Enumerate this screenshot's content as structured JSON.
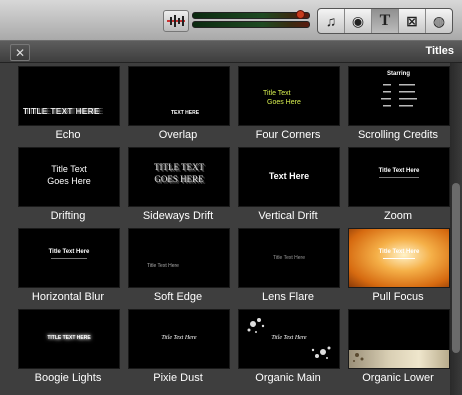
{
  "panel": {
    "title": "Titles",
    "close_glyph": "✕"
  },
  "toolbar": {
    "audio_button": "audio-waveform-icon",
    "buttons": [
      {
        "name": "music-icon",
        "glyph": "♫"
      },
      {
        "name": "camera-icon",
        "glyph": "◉"
      },
      {
        "name": "titles-icon",
        "glyph": "T"
      },
      {
        "name": "transitions-icon",
        "glyph": "⊠"
      },
      {
        "name": "globe-icon",
        "glyph": "◍"
      }
    ]
  },
  "tiles": [
    {
      "label": "Echo",
      "preview": [
        "TITLE TEXT HERE"
      ]
    },
    {
      "label": "Overlap",
      "preview": [
        "TEXT HERE"
      ]
    },
    {
      "label": "Four Corners",
      "preview": [
        "Title Text",
        "Goes Here"
      ]
    },
    {
      "label": "Scrolling Credits",
      "preview": [
        "Starring"
      ]
    },
    {
      "label": "Drifting",
      "preview": [
        "Title Text",
        "Goes Here"
      ]
    },
    {
      "label": "Sideways Drift",
      "preview": [
        "TITLE TEXT",
        "GOES HERE"
      ]
    },
    {
      "label": "Vertical Drift",
      "preview": [
        "Text Here"
      ]
    },
    {
      "label": "Zoom",
      "preview": [
        "Title Text Here"
      ]
    },
    {
      "label": "Horizontal Blur",
      "preview": [
        "Title Text Here"
      ]
    },
    {
      "label": "Soft Edge",
      "preview": [
        "Title Text Here"
      ]
    },
    {
      "label": "Lens Flare",
      "preview": [
        "Title Text Here"
      ]
    },
    {
      "label": "Pull Focus",
      "preview": [
        "Title Text Here"
      ]
    },
    {
      "label": "Boogie Lights",
      "preview": [
        "TITLE TEXT HERE"
      ]
    },
    {
      "label": "Pixie Dust",
      "preview": [
        "Title Text Here"
      ]
    },
    {
      "label": "Organic Main",
      "preview": [
        "Title Text Here"
      ]
    },
    {
      "label": "Organic Lower",
      "preview": [
        ""
      ]
    }
  ]
}
